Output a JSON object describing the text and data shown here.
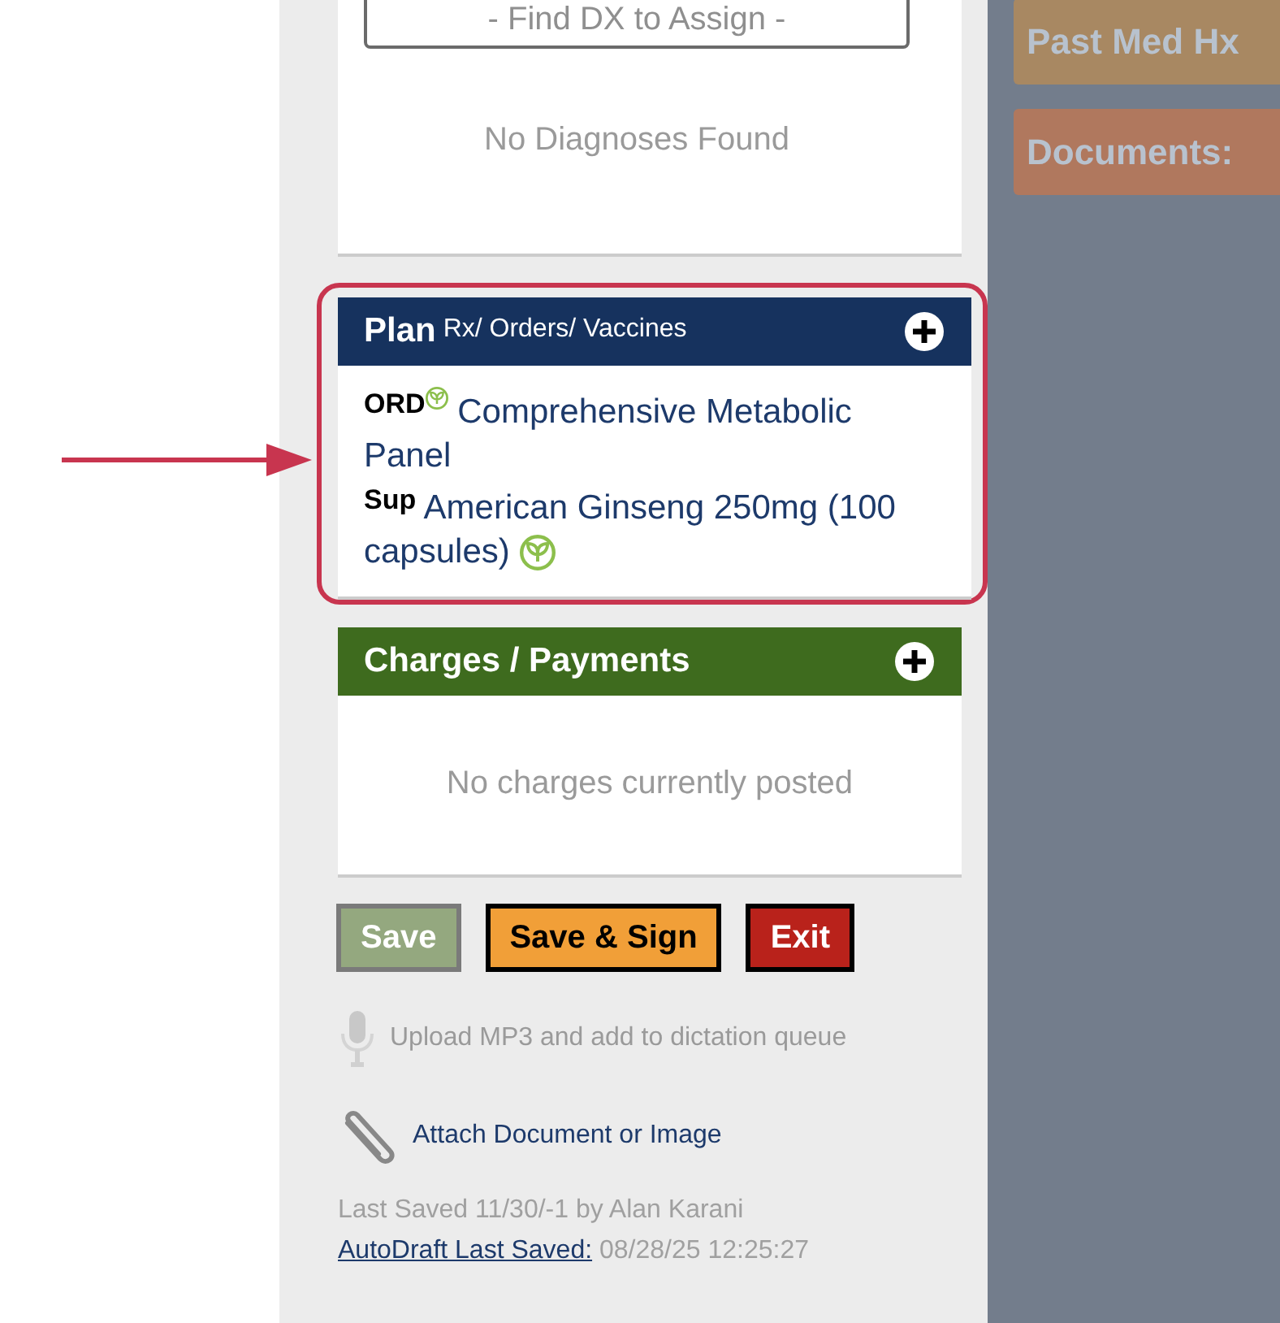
{
  "diagnoses": {
    "search_placeholder": "- Find DX to Assign -",
    "empty_message": "No Diagnoses Found"
  },
  "plan": {
    "title": "Plan",
    "subtitle": "Rx/ Orders/ Vaccines",
    "highlighted": true,
    "items": [
      {
        "type": "ORD",
        "name": "Comprehensive Metabolic Panel",
        "kind": "leafbefore"
      },
      {
        "type": "Sup",
        "name": "American Ginseng 250mg (100 capsules)",
        "kind": "leafafter"
      }
    ]
  },
  "charges": {
    "title": "Charges / Payments",
    "empty_message": "No charges currently posted"
  },
  "buttons": [
    {
      "label": "Save",
      "kind": "save"
    },
    {
      "label": "Save & Sign",
      "kind": "sign"
    },
    {
      "label": "Exit",
      "kind": "exit"
    }
  ],
  "links": [
    {
      "label": "Upload MP3 and add to dictation queue",
      "kind": "dictation",
      "disabled": true
    },
    {
      "label": "Attach Document or Image",
      "kind": "attach",
      "disabled": false
    }
  ],
  "last_saved": "Last Saved 11/30/-1 by Alan Karani",
  "autodraft": {
    "link": "AutoDraft Last Saved:",
    "time": "08/28/25 12:25:27"
  },
  "side_tiles": [
    {
      "label": "Past Med Hx",
      "color": "#a88862"
    },
    {
      "label": "Documents:",
      "color": "#b0785e"
    }
  ]
}
